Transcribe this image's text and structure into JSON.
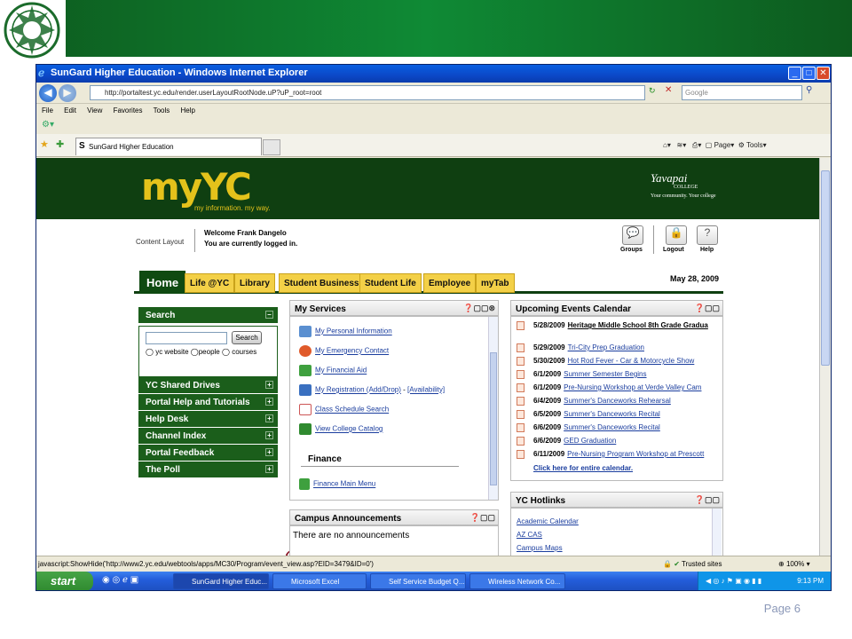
{
  "slide": {
    "page_label": "Page 6"
  },
  "window": {
    "title": "SunGard Higher Education - Windows Internet Explorer",
    "address": "http://portaltest.yc.edu/render.userLayoutRootNode.uP?uP_root=root",
    "search_placeholder": "Google",
    "menu": [
      "File",
      "Edit",
      "View",
      "Favorites",
      "Tools",
      "Help"
    ],
    "tab_title": "SunGard Higher Education",
    "right_tools": {
      "page": "Page",
      "tools": "Tools"
    }
  },
  "portal": {
    "logo": "myYC",
    "tagline": "my information. my way.",
    "college_logo": "Yavapai",
    "college_sub": "COLLEGE",
    "college_tag": "Your community. Your college",
    "content_layout": "Content Layout",
    "welcome": "Welcome Frank Dangelo",
    "logged_in": "You are currently logged in.",
    "top_icons": [
      "Groups",
      "Logout",
      "Help"
    ],
    "tabs": [
      "Home",
      "Life @YC",
      "Library",
      "Student Business",
      "Student Life",
      "Employee",
      "myTab"
    ],
    "date": "May 28, 2009",
    "search": {
      "title": "Search",
      "button": "Search",
      "radio_options": [
        "yc website",
        "people",
        "courses"
      ]
    },
    "channels": [
      "YC Shared Drives",
      "Portal Help and Tutorials",
      "Help Desk",
      "Channel Index",
      "Portal Feedback",
      "The Poll"
    ],
    "my_services": {
      "title": "My Services",
      "items": [
        "My Personal Information",
        "My Emergency Contact",
        "My Financial Aid",
        "My Registration (Add/Drop)",
        "Class Schedule Search",
        "View College Catalog"
      ],
      "availability": "[Availability]",
      "finance_heading": "Finance",
      "finance_item": "Finance Main Menu"
    },
    "announcements": {
      "title": "Campus Announcements",
      "text": "There are no announcements"
    },
    "events": {
      "title": "Upcoming Events Calendar",
      "items": [
        {
          "date": "5/28/2009",
          "name": "Heritage Middle School 8th Grade Gradua"
        },
        {
          "date": "5/29/2009",
          "name": "Tri-City Prep Graduation"
        },
        {
          "date": "5/30/2009",
          "name": "Hot Rod Fever - Car & Motorcycle Show"
        },
        {
          "date": "6/1/2009",
          "name": "Summer Semester Begins"
        },
        {
          "date": "6/1/2009",
          "name": "Pre-Nursing Workshop at Verde Valley Cam"
        },
        {
          "date": "6/4/2009",
          "name": "Summer's Danceworks Rehearsal"
        },
        {
          "date": "6/5/2009",
          "name": "Summer's Danceworks Recital"
        },
        {
          "date": "6/6/2009",
          "name": "Summer's Danceworks Recital"
        },
        {
          "date": "6/6/2009",
          "name": "GED Graduation"
        },
        {
          "date": "6/11/2009",
          "name": "Pre-Nursing Program Workshop at Prescott"
        }
      ],
      "more_link": "Click here for entire calendar."
    },
    "hotlinks": {
      "title": "YC Hotlinks",
      "items": [
        "Academic Calendar",
        "AZ CAS",
        "Campus Maps"
      ]
    }
  },
  "statusbar": {
    "text": "javascript:ShowHide('http://www2.yc.edu/webtools/apps/MC30/Program/event_view.asp?EID=3479&ID=0')",
    "zone": "Trusted sites",
    "zoom": "100%"
  },
  "taskbar": {
    "start": "start",
    "tasks": [
      "SunGard Higher Educ...",
      "Microsoft Excel",
      "Self Service Budget Q...",
      "Wireless Network Co..."
    ],
    "clock": "9:13 PM"
  },
  "colors": {
    "portal_green": "#0f3f11",
    "tab_yellow": "#f3d047",
    "logo_yellow": "#e4c21b",
    "oval": "#8c1a2a"
  }
}
